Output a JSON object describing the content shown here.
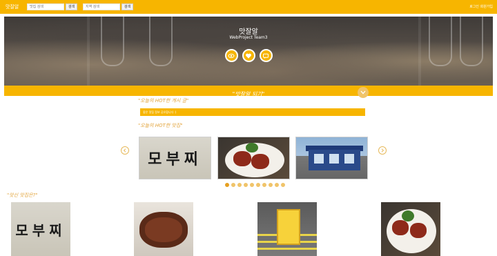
{
  "header": {
    "brand": "맛잘알",
    "search1_placeholder": "맛집 검색",
    "search1_button": "검색",
    "search2_placeholder": "지역 검색",
    "search2_button": "검색",
    "right_text": "로그인 회원가입"
  },
  "hero": {
    "title": "맛잘알",
    "subtitle": "WebProject Team3",
    "buttons": [
      "eye-icon",
      "heart-icon",
      "message-icon"
    ]
  },
  "strip": {
    "text": "\"맛잘알 되기\""
  },
  "sections": {
    "hottest_post_title": "\"오늘의 HOT한 게시 글\"",
    "hottest_post_text": "좋은 맛집 정보 공유합니다 :)",
    "hottest_places_title": "\"오늘의 HOT한 맛집\"",
    "new_places_title": "\"맛신 맛집은?\""
  },
  "carousel": {
    "cards": [
      {
        "kind": "sign",
        "text": "모부찌"
      },
      {
        "kind": "plate"
      },
      {
        "kind": "store"
      }
    ],
    "dot_count": 10,
    "active_dot": 0
  },
  "gallery": {
    "items": [
      {
        "kind": "sign",
        "text": "모부찌"
      },
      {
        "kind": "burger"
      },
      {
        "kind": "stand"
      },
      {
        "kind": "plate"
      }
    ]
  },
  "colors": {
    "accent": "#f7b500",
    "title_text": "#e2a33a"
  }
}
